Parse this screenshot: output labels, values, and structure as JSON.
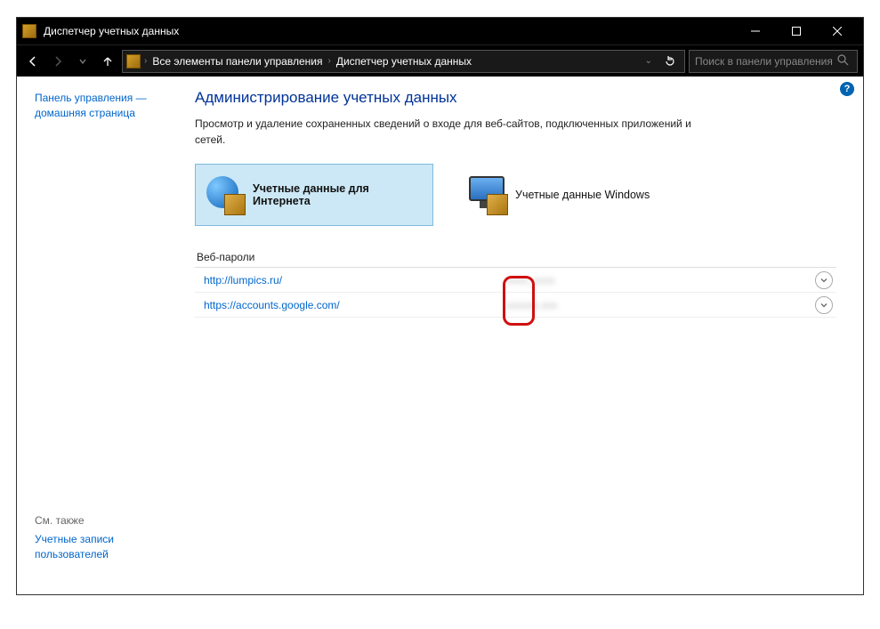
{
  "window": {
    "title": "Диспетчер учетных данных"
  },
  "breadcrumb": {
    "item1": "Все элементы панели управления",
    "item2": "Диспетчер учетных данных"
  },
  "search": {
    "placeholder": "Поиск в панели управления"
  },
  "sidebar": {
    "home_line1": "Панель управления —",
    "home_line2": "домашняя страница",
    "see_also_label": "См. также",
    "see_also_link_line1": "Учетные записи",
    "see_also_link_line2": "пользователей"
  },
  "page": {
    "title": "Администрирование учетных данных",
    "description": "Просмотр и удаление сохраненных сведений о входе для веб-сайтов, подключенных приложений и сетей."
  },
  "tiles": {
    "internet": "Учетные данные для Интернета",
    "windows": "Учетные данные Windows"
  },
  "section": {
    "web_passwords": "Веб-пароли"
  },
  "creds": [
    {
      "url": "http://lumpics.ru/",
      "user": "xxxx_xxxx"
    },
    {
      "url": "https://accounts.google.com/",
      "user": "xxxxxx.xxx"
    }
  ]
}
